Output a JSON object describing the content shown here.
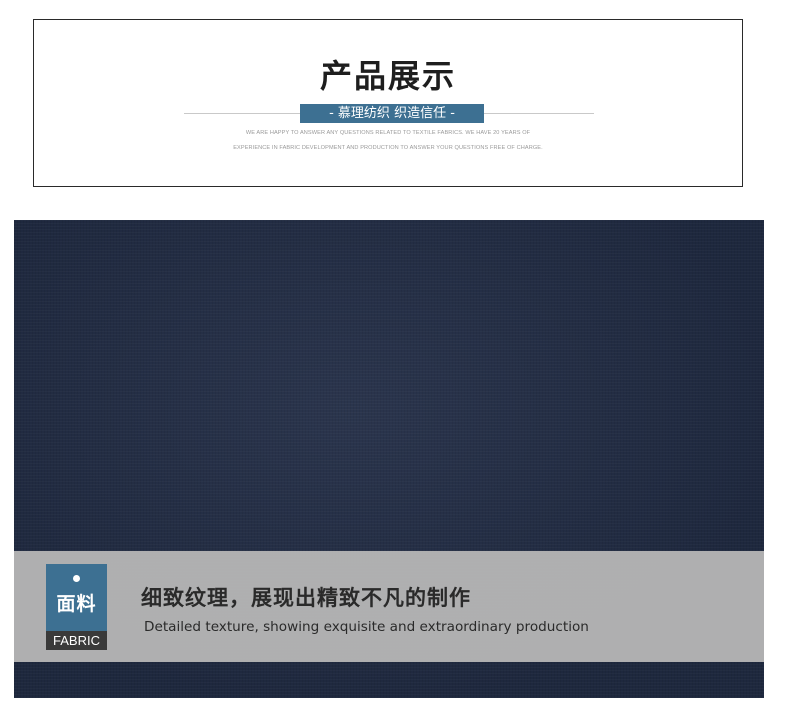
{
  "header": {
    "title": "产品展示",
    "subtitle": "- 慕理纺织 织造信任 -",
    "description_line_1": "WE ARE HAPPY TO ANSWER ANY QUESTIONS RELATED TO TEXTILE FABRICS. WE HAVE 20 YEARS OF",
    "description_line_2": "EXPERIENCE IN FABRIC DEVELOPMENT AND PRODUCTION TO ANSWER YOUR QUESTIONS FREE OF CHARGE."
  },
  "fabric_section": {
    "badge_cn": "面料",
    "badge_en": "FABRIC",
    "caption_cn": "细致纹理，展现出精致不凡的制作",
    "caption_en": "Detailed texture, showing exquisite and extraordinary production"
  },
  "colors": {
    "accent_blue": "#3d7092",
    "fabric_navy": "#222d46",
    "band_gray": "#b5b5b5",
    "badge_dark": "#3a3a3a"
  }
}
